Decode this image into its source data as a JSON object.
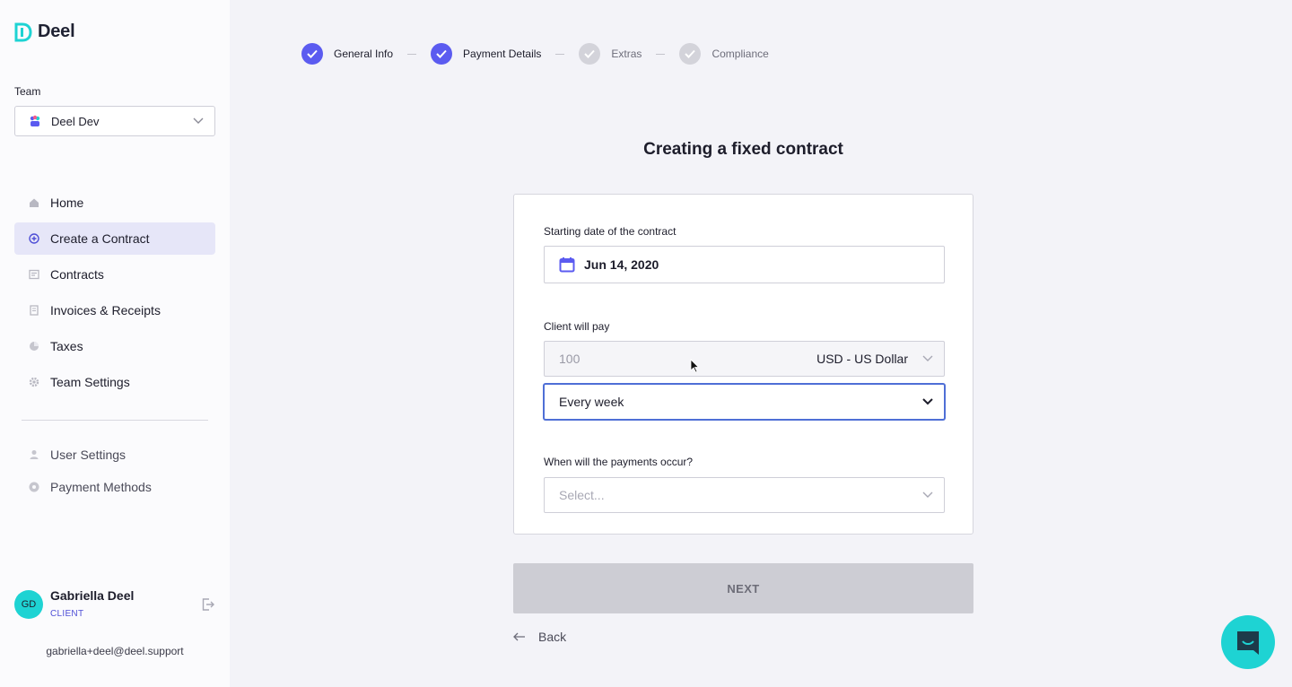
{
  "brand": {
    "name": "Deel"
  },
  "sidebar": {
    "team_label": "Team",
    "team_name": "Deel Dev",
    "nav": [
      {
        "label": "Home",
        "icon": "home-icon"
      },
      {
        "label": "Create a Contract",
        "icon": "plus-circle-icon"
      },
      {
        "label": "Contracts",
        "icon": "contract-icon"
      },
      {
        "label": "Invoices & Receipts",
        "icon": "invoice-icon"
      },
      {
        "label": "Taxes",
        "icon": "pie-chart-icon"
      },
      {
        "label": "Team Settings",
        "icon": "gear-icon"
      }
    ],
    "secondary_nav": [
      {
        "label": "User Settings",
        "icon": "user-icon"
      },
      {
        "label": "Payment Methods",
        "icon": "payment-icon"
      }
    ],
    "user": {
      "initials": "GD",
      "name": "Gabriella Deel",
      "role": "CLIENT",
      "email": "gabriella+deel@deel.support"
    }
  },
  "stepper": {
    "steps": [
      {
        "label": "General Info",
        "status": "done"
      },
      {
        "label": "Payment Details",
        "status": "done"
      },
      {
        "label": "Extras",
        "status": "todo"
      },
      {
        "label": "Compliance",
        "status": "todo"
      }
    ]
  },
  "main": {
    "title": "Creating a fixed contract",
    "start_date_label": "Starting date of the contract",
    "start_date_value": "Jun 14, 2020",
    "client_pay_label": "Client will pay",
    "amount_placeholder": "100",
    "currency_value": "USD - US Dollar",
    "frequency_value": "Every week",
    "payments_label": "When will the payments occur?",
    "payments_placeholder": "Select...",
    "next_label": "NEXT",
    "back_label": "Back"
  },
  "colors": {
    "accent": "#5b5bf0",
    "teal": "#1ed3d3",
    "active_nav_bg": "#e6e6f8"
  }
}
